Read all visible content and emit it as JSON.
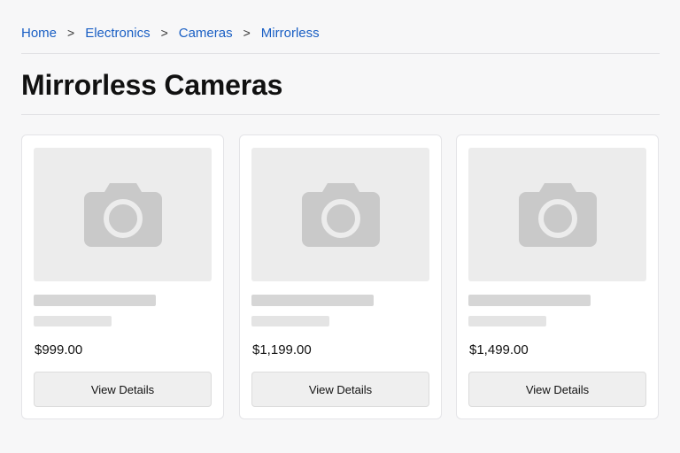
{
  "breadcrumb": {
    "items": [
      {
        "label": "Home"
      },
      {
        "label": "Electronics"
      },
      {
        "label": "Cameras"
      },
      {
        "label": "Mirrorless"
      }
    ],
    "separator": ">"
  },
  "page": {
    "title": "Mirrorless Cameras"
  },
  "products": [
    {
      "image_icon": "camera-icon",
      "price": "$999.00",
      "button_label": "View Details"
    },
    {
      "image_icon": "camera-icon",
      "price": "$1,199.00",
      "button_label": "View Details"
    },
    {
      "image_icon": "camera-icon",
      "price": "$1,499.00",
      "button_label": "View Details"
    }
  ],
  "colors": {
    "link": "#1a5fc4",
    "background": "#f7f7f8",
    "placeholder_icon": "#c9c9c9",
    "skeleton": "#d6d6d6"
  }
}
